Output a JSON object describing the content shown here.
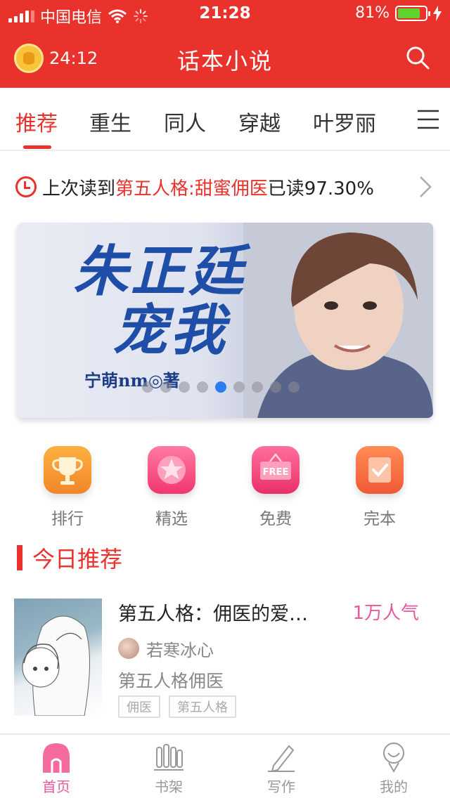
{
  "status": {
    "carrier": "中国电信",
    "time": "21:28",
    "battery": "81%",
    "battery_level": 0.81
  },
  "header": {
    "timer": "24:12",
    "title": "话本小说",
    "icons": {
      "timer": "coin-clock-icon",
      "search": "search-icon"
    }
  },
  "tabs": [
    {
      "label": "推荐",
      "active": true
    },
    {
      "label": "重生"
    },
    {
      "label": "同人"
    },
    {
      "label": "穿越"
    },
    {
      "label": "叶罗丽"
    }
  ],
  "last_read": {
    "prefix": "上次读到",
    "book": "第五人格:甜蜜佣医",
    "progress": "已读97.30%"
  },
  "banner": {
    "title_line1": "朱正廷",
    "title_line2": "宠我",
    "author": "宁萌nm◎著",
    "slide_count": 9,
    "active_slide": 5
  },
  "categories": [
    {
      "label": "排行",
      "icon": "trophy-icon",
      "color": "#f7932f"
    },
    {
      "label": "精选",
      "icon": "star-icon",
      "color": "#f1376f"
    },
    {
      "label": "免费",
      "icon": "free-sign-icon",
      "color": "#ea3068"
    },
    {
      "label": "完本",
      "icon": "check-icon",
      "color": "#f05a35"
    }
  ],
  "section": {
    "title": "今日推荐"
  },
  "book": {
    "title": "第五人格：佣医的爱…",
    "popularity": "1万人气",
    "author": "若寒冰心",
    "description": "第五人格佣医",
    "tags": [
      "佣医",
      "第五人格"
    ]
  },
  "nav": [
    {
      "label": "首页",
      "icon": "home-icon",
      "active": true
    },
    {
      "label": "书架",
      "icon": "bookshelf-icon"
    },
    {
      "label": "写作",
      "icon": "pen-icon"
    },
    {
      "label": "我的",
      "icon": "user-icon"
    }
  ]
}
